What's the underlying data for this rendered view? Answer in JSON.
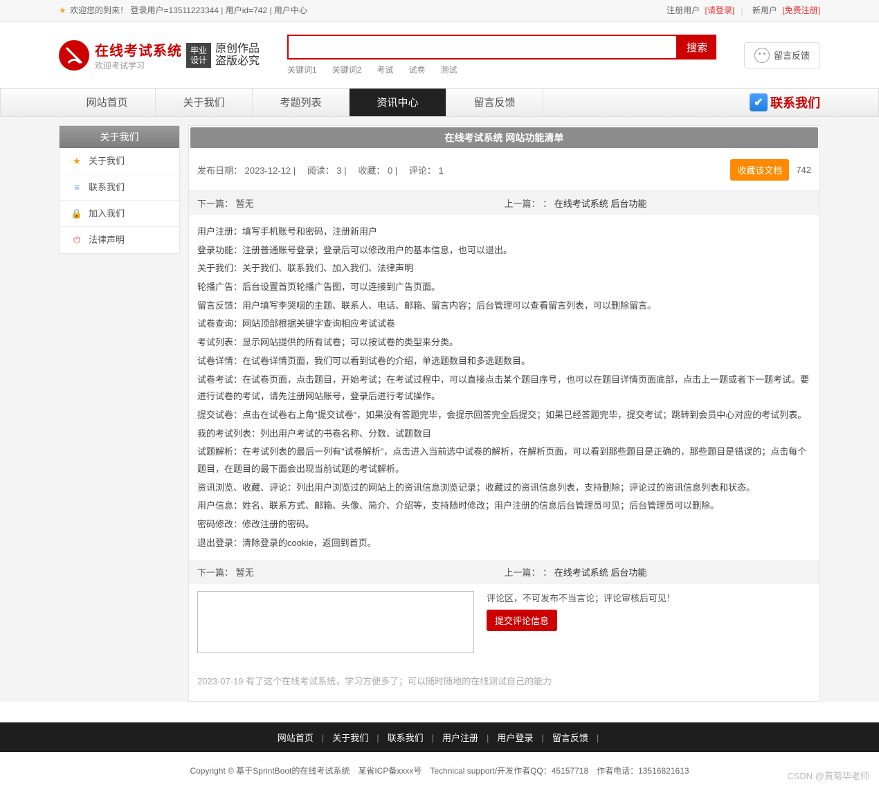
{
  "topbar": {
    "welcome": "欢迎您的到来！ 登录用户=13511223344 | 用户id=742 | 用户中心",
    "reg_user": "注册用户",
    "login_link": "[请登录]",
    "new_user": "新用户",
    "free_reg": "[免费注册]"
  },
  "header": {
    "title": "在线考试系统",
    "subtitle": "欢迎考试学习",
    "grad1": "毕业",
    "grad2": "设计",
    "script1": "原创作品",
    "script2": "盗版必究",
    "search_btn": "搜索",
    "keywords": [
      "关键词1",
      "关键词2",
      "考试",
      "试卷",
      "测试"
    ],
    "feedback": "留言反馈"
  },
  "nav": {
    "items": [
      "网站首页",
      "关于我们",
      "考题列表",
      "资讯中心",
      "留言反馈"
    ],
    "active_index": 3,
    "contact": "联系我们"
  },
  "sidebar": {
    "head": "关于我们",
    "items": [
      {
        "icon": "star",
        "color": "c-orange",
        "label": "关于我们"
      },
      {
        "icon": "list",
        "color": "c-blue",
        "label": "联系我们"
      },
      {
        "icon": "lock",
        "color": "c-orange",
        "label": "加入我们"
      },
      {
        "icon": "power",
        "color": "c-red",
        "label": "法律声明"
      }
    ]
  },
  "article": {
    "title": "在线考试系统 网站功能清单",
    "meta_date_label": "发布日期：",
    "meta_date": "2023-12-12",
    "meta_read_label": "阅读：",
    "meta_read": "3",
    "meta_fav_label": "收藏：",
    "meta_fav": "0",
    "meta_comment_label": "评论：",
    "meta_comment": "1",
    "fav_btn": "收藏该文档",
    "fav_count": "742",
    "prev_label": "下一篇：",
    "prev_value": "暂无",
    "next_label": "上一篇：",
    "next_sep": "：",
    "next_value": "在线考试系统 后台功能",
    "body": [
      "用户注册：填写手机账号和密码，注册新用户",
      "登录功能：注册普通账号登录；登录后可以修改用户的基本信息，也可以退出。",
      "关于我们：关于我们、联系我们、加入我们、法律声明",
      "轮播广告：后台设置首页轮播广告图，可以连接到广告页面。",
      "留言反馈：用户填写李哭咽的主题、联系人、电话、邮箱、留言内容；后台管理可以查看留言列表，可以删除留言。",
      "试卷查询：网站顶部根据关键字查询相应考试试卷",
      "考试列表：显示网站提供的所有试卷；可以按试卷的类型来分类。",
      "试卷详情：在试卷详情页面，我们可以看到试卷的介绍，单选题数目和多选题数目。",
      "试卷考试：在试卷页面，点击题目，开始考试；在考试过程中，可以直接点击某个题目序号，也可以在题目详情页面底部，点击上一题或者下一题考试。要进行试卷的考试，请先注册网站账号，登录后进行考试操作。",
      "提交试卷：点击在试卷右上角\"提交试卷\"，如果没有答题完毕，会提示回答完全后提交；如果已经答题完毕，提交考试；跳转到会员中心对应的考试列表。",
      "我的考试列表：列出用户考试的书卷名称、分数、试题数目",
      "试题解析：在考试列表的最后一列有\"试卷解析\"，点击进入当前选中试卷的解析，在解析页面，可以看到那些题目是正确的，那些题目是错误的；点击每个题目，在题目的最下面会出现当前试题的考试解析。",
      "资讯浏览、收藏、评论：列出用户浏览过的网站上的资讯信息浏览记录；收藏过的资讯信息列表，支持删除；评论过的资讯信息列表和状态。",
      "用户信息：姓名、联系方式、邮箱、头像、简介、介绍等，支持随时修改；用户注册的信息后台管理员可见；后台管理员可以删除。",
      "密码修改：修改注册的密码。",
      "退出登录：清除登录的cookie，返回到首页。"
    ]
  },
  "comment": {
    "note": "评论区，不可发布不当言论；评论审核后可见！",
    "submit": "提交评论信息",
    "history": "2023-07-19 有了这个在线考试系统，学习方便多了；可以随时随地的在线测试自己的能力"
  },
  "footer": {
    "nav": [
      "网站首页",
      "关于我们",
      "联系我们",
      "用户注册",
      "用户登录",
      "留言反馈"
    ],
    "info": "Copyright © 基于SprintBoot的在线考试系统　某省ICP备xxxx号　Technical support/开发作者QQ：45157718　作者电话：13516821613",
    "watermark": "CSDN @黄菊华老师"
  }
}
